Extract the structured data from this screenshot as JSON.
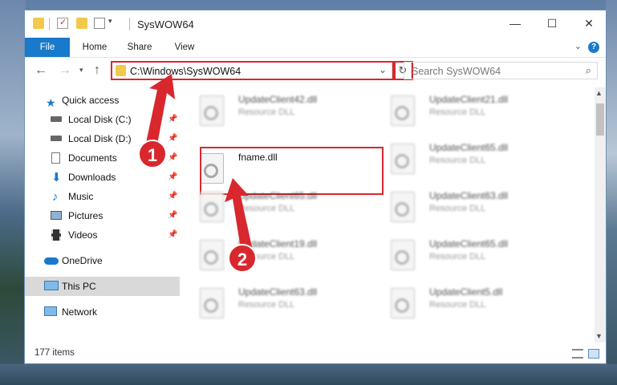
{
  "window": {
    "title": "SysWOW64",
    "controls": {
      "minimize": "—",
      "maximize": "☐",
      "close": "✕"
    }
  },
  "ribbon": {
    "tabs": [
      "File",
      "Home",
      "Share",
      "View"
    ],
    "help": "?"
  },
  "address": {
    "path": "C:\\Windows\\SysWOW64",
    "refresh_icon": "↻"
  },
  "search": {
    "placeholder": "Search SysWOW64"
  },
  "sidebar": {
    "quick_access": "Quick access",
    "items": [
      {
        "label": "Local Disk (C:)",
        "icon": "drive-icon",
        "pinned": true
      },
      {
        "label": "Local Disk (D:)",
        "icon": "drive-icon",
        "pinned": true
      },
      {
        "label": "Documents",
        "icon": "documents-icon",
        "pinned": true
      },
      {
        "label": "Downloads",
        "icon": "downloads-icon",
        "pinned": true
      },
      {
        "label": "Music",
        "icon": "music-icon",
        "pinned": true
      },
      {
        "label": "Pictures",
        "icon": "pictures-icon",
        "pinned": true
      },
      {
        "label": "Videos",
        "icon": "videos-icon",
        "pinned": true
      }
    ],
    "onedrive": "OneDrive",
    "this_pc": "This PC",
    "network": "Network"
  },
  "files": {
    "focused": {
      "name": "fname.dll"
    },
    "left_column": [
      {
        "name": "UpdateClient42.dll",
        "type": "Resource DLL"
      },
      {
        "name": "UpdateClient65.dll",
        "type": "Resource DLL"
      },
      {
        "name": "UpdateClient19.dll",
        "type": "Resource DLL"
      },
      {
        "name": "UpdateClient63.dll",
        "type": "Resource DLL"
      }
    ],
    "right_column": [
      {
        "name": "UpdateClient21.dll",
        "type": "Resource DLL"
      },
      {
        "name": "UpdateClient65.dll",
        "type": "Resource DLL"
      },
      {
        "name": "UpdateClient63.dll",
        "type": "Resource DLL"
      },
      {
        "name": "UpdateClient65.dll",
        "type": "Resource DLL"
      },
      {
        "name": "UpdateClient5.dll",
        "type": "Resource DLL"
      }
    ]
  },
  "status": {
    "item_count": "177 items"
  },
  "annotations": {
    "step1": "1",
    "step2": "2",
    "accent": "#d9272e"
  }
}
